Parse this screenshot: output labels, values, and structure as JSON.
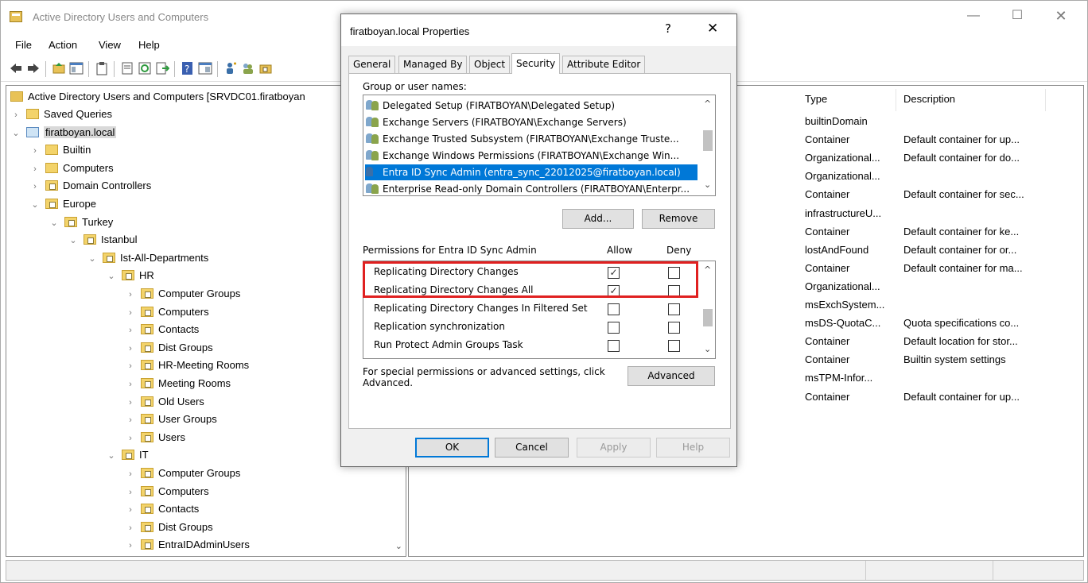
{
  "window": {
    "title": "Active Directory Users and Computers",
    "controls": {
      "minimize": "—",
      "maximize": "☐",
      "close": "✕"
    }
  },
  "menu": [
    "File",
    "Action",
    "View",
    "Help"
  ],
  "tree": {
    "root": "Active Directory Users and Computers [SRVDC01.firatboyan",
    "items": [
      {
        "label": "Saved Queries",
        "chevron": "›"
      },
      {
        "label": "firatboyan.local",
        "chevron": "⌄"
      },
      {
        "label": "Builtin",
        "chevron": "›"
      },
      {
        "label": "Computers",
        "chevron": "›"
      },
      {
        "label": "Domain Controllers",
        "chevron": "›"
      },
      {
        "label": "Europe",
        "chevron": "⌄"
      },
      {
        "label": "Turkey",
        "chevron": "⌄"
      },
      {
        "label": "Istanbul",
        "chevron": "⌄"
      },
      {
        "label": "Ist-All-Departments",
        "chevron": "⌄"
      },
      {
        "label": "HR",
        "chevron": "⌄"
      },
      {
        "label": "Computer Groups",
        "chevron": "›"
      },
      {
        "label": "Computers",
        "chevron": "›"
      },
      {
        "label": "Contacts",
        "chevron": "›"
      },
      {
        "label": "Dist Groups",
        "chevron": "›"
      },
      {
        "label": "HR-Meeting Rooms",
        "chevron": "›"
      },
      {
        "label": "Meeting Rooms",
        "chevron": "›"
      },
      {
        "label": "Old Users",
        "chevron": "›"
      },
      {
        "label": "User Groups",
        "chevron": "›"
      },
      {
        "label": "Users",
        "chevron": "›"
      },
      {
        "label": "IT",
        "chevron": "⌄"
      },
      {
        "label": "Computer Groups",
        "chevron": "›"
      },
      {
        "label": "Computers",
        "chevron": "›"
      },
      {
        "label": "Contacts",
        "chevron": "›"
      },
      {
        "label": "Dist Groups",
        "chevron": "›"
      },
      {
        "label": "EntraIDAdminUsers",
        "chevron": "›"
      }
    ]
  },
  "list": {
    "columns": [
      "Type",
      "Description"
    ],
    "rows": [
      [
        "builtinDomain",
        ""
      ],
      [
        "Container",
        "Default container for up..."
      ],
      [
        "Organizational...",
        "Default container for do..."
      ],
      [
        "Organizational...",
        ""
      ],
      [
        "Container",
        "Default container for sec..."
      ],
      [
        "infrastructureU...",
        ""
      ],
      [
        "Container",
        "Default container for ke..."
      ],
      [
        "lostAndFound",
        "Default container for or..."
      ],
      [
        "Container",
        "Default container for ma..."
      ],
      [
        "Organizational...",
        ""
      ],
      [
        "msExchSystem...",
        ""
      ],
      [
        "msDS-QuotaC...",
        "Quota specifications co..."
      ],
      [
        "Container",
        "Default location for stor..."
      ],
      [
        "Container",
        "Builtin system settings"
      ],
      [
        "msTPM-Infor...",
        ""
      ],
      [
        "Container",
        "Default container for up..."
      ]
    ]
  },
  "dialog": {
    "title": "firatboyan.local Properties",
    "help": "?",
    "close": "✕",
    "tabs": [
      "General",
      "Managed By",
      "Object",
      "Security",
      "Attribute Editor"
    ],
    "active_tab": "Security",
    "group_label": "Group or user names:",
    "users": [
      "Delegated Setup (FIRATBOYAN\\Delegated Setup)",
      "Exchange Servers (FIRATBOYAN\\Exchange Servers)",
      "Exchange Trusted Subsystem (FIRATBOYAN\\Exchange Truste...",
      "Exchange Windows Permissions (FIRATBOYAN\\Exchange Win...",
      "Entra ID Sync Admin (entra_sync_22012025@firatboyan.local)",
      "Enterprise Read-only Domain Controllers (FIRATBOYAN\\Enterpr..."
    ],
    "selected_user_index": 4,
    "add_button": "Add...",
    "remove_button": "Remove",
    "permissions_label": "Permissions for Entra ID Sync Admin",
    "allow_label": "Allow",
    "deny_label": "Deny",
    "permissions": [
      {
        "name": "Replicating Directory Changes",
        "allow": true,
        "deny": false
      },
      {
        "name": "Replicating Directory Changes All",
        "allow": true,
        "deny": false
      },
      {
        "name": "Replicating Directory Changes In Filtered Set",
        "allow": false,
        "deny": false
      },
      {
        "name": "Replication synchronization",
        "allow": false,
        "deny": false
      },
      {
        "name": "Run Protect Admin Groups Task",
        "allow": false,
        "deny": false
      }
    ],
    "advanced_text_line1": "For special permissions or advanced settings, click",
    "advanced_text_line2": "Advanced.",
    "advanced_button": "Advanced",
    "ok": "OK",
    "cancel": "Cancel",
    "apply": "Apply",
    "help_button": "Help"
  },
  "colors": {
    "selection": "#0078d7",
    "highlight_box": "#e02020",
    "folder": "#f3d36a"
  }
}
